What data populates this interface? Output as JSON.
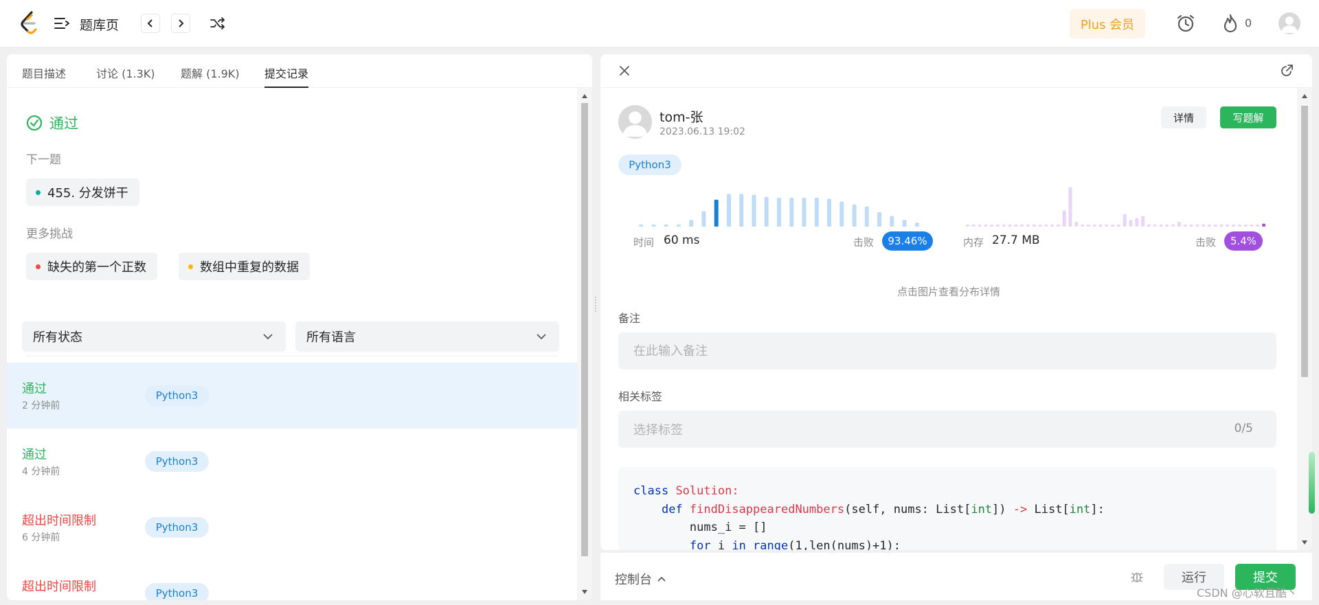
{
  "topbar": {
    "title": "题库页",
    "plus_label": "Plus 会员",
    "streak_count": "0"
  },
  "left": {
    "tabs": [
      "题目描述",
      "讨论 (1.3K)",
      "题解 (1.9K)",
      "提交记录"
    ],
    "active_tab": "提交记录",
    "pass_title": "通过",
    "next_label": "下一题",
    "next_problem": "455. 分发饼干",
    "more_label": "更多挑战",
    "challenges": [
      {
        "title": "缺失的第一个正数",
        "color": "#ef4743"
      },
      {
        "title": "数组中重复的数据",
        "color": "#ffb800"
      }
    ],
    "filter_status": "所有状态",
    "filter_lang": "所有语言",
    "submissions": [
      {
        "status": "通过",
        "time": "2 分钟前",
        "lang": "Python3"
      },
      {
        "status": "通过",
        "time": "4 分钟前",
        "lang": "Python3"
      },
      {
        "status": "超出时间限制",
        "time": "6 分钟前",
        "lang": "Python3"
      },
      {
        "status": "超出时间限制",
        "time": "",
        "lang": "Python3"
      }
    ]
  },
  "right": {
    "username": "tom-张",
    "date": "2023.06.13 19:02",
    "detail_btn": "详情",
    "write_btn": "写题解",
    "lang": "Python3",
    "time_label": "时间",
    "time_value": "60 ms",
    "beat_label": "击败",
    "time_beat": "93.46%",
    "mem_label": "内存",
    "mem_value": "27.7 MB",
    "mem_beat": "5.4%",
    "hint": "点击图片查看分布详情",
    "note_label": "备注",
    "note_placeholder": "在此输入备注",
    "tags_label": "相关标签",
    "tags_placeholder": "选择标签",
    "tags_count": "0/5",
    "code": {
      "l1_kw": "class",
      "l1_name": "Solution:",
      "l2_kw": "def",
      "l2_fn": "findDisappearedNumbers",
      "l2_params": "(self, nums: List[",
      "l2_int": "int",
      "l2_mid": "]) ",
      "l2_arrow": "->",
      "l2_ret": " List[",
      "l2_int2": "int",
      "l2_end": "]:",
      "l3": "nums_i = []",
      "l4_for": "for",
      "l4_i": " i ",
      "l4_in": "in",
      "l4_range": " range",
      "l4_rest": "(1,len(nums)+1):"
    }
  },
  "bottom": {
    "console": "控制台",
    "run": "运行",
    "submit": "提交"
  },
  "watermark": "CSDN @心软且酷丶",
  "hist_data": {
    "runtime": [
      0.04,
      0.04,
      0.04,
      0.04,
      0.14,
      0.32,
      0.56,
      0.68,
      0.68,
      0.66,
      0.62,
      0.6,
      0.6,
      0.6,
      0.6,
      0.58,
      0.52,
      0.46,
      0.42,
      0.3,
      0.22,
      0.14,
      0.08
    ],
    "runtime_highlight": 6,
    "memory": [
      0.04,
      0.04,
      0.04,
      0.04,
      0.04,
      0.04,
      0.04,
      0.04,
      0.04,
      0.04,
      0.04,
      0.04,
      0.04,
      0.04,
      0.04,
      0.04,
      0.34,
      0.82,
      0.1,
      0.04,
      0.04,
      0.04,
      0.04,
      0.04,
      0.04,
      0.04,
      0.26,
      0.14,
      0.18,
      0.22,
      0.04,
      0.04,
      0.04,
      0.04,
      0.04,
      0.1,
      0.04,
      0.04,
      0.04,
      0.04,
      0.04,
      0.04,
      0.04,
      0.04,
      0.04,
      0.04,
      0.04,
      0.04,
      0.04,
      0.06
    ],
    "memory_highlight": 49
  },
  "colors": {
    "accent_green": "#2db55d",
    "runtime_bar": "#bfdcf7",
    "runtime_highlight": "#1a7fd1",
    "memory_bar": "#ead4f7",
    "memory_highlight": "#a651d8",
    "beat_time": "#1a7fe8",
    "beat_mem": "#a24ede"
  }
}
